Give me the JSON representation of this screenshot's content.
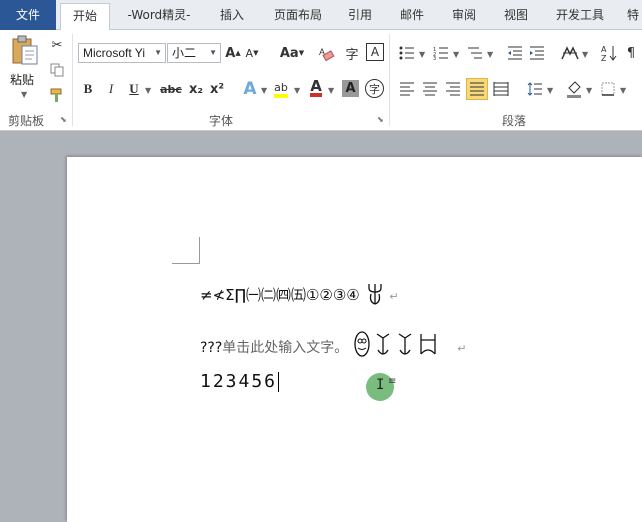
{
  "tabs": {
    "file": "文件",
    "home": "开始",
    "word_spirit": "-Word精灵-",
    "insert": "插入",
    "page_layout": "页面布局",
    "references": "引用",
    "mailings": "邮件",
    "review": "审阅",
    "view": "视图",
    "developer": "开发工具",
    "more": "特"
  },
  "ribbon": {
    "clipboard": {
      "paste_label": "粘贴",
      "group_label": "剪贴板"
    },
    "font": {
      "font_name": "Microsoft Yi",
      "font_size": "小二",
      "group_label": "字体",
      "bold": "B",
      "italic": "I",
      "underline": "U",
      "strike": "abc",
      "subscript": "x₂",
      "superscript": "x²",
      "grow": "A",
      "shrink": "A",
      "change_case": "Aa",
      "phonetic": "字",
      "border_char": "A",
      "text_effect": "A",
      "highlight": "ab",
      "font_color": "A",
      "char_shading": "A",
      "enclose": "字"
    },
    "paragraph": {
      "group_label": "段落"
    }
  },
  "document": {
    "symbols_line": "≠≮Σ∏㈠㈡㈣㈤①②③④",
    "special_glyph_1": "ꝋ",
    "text_prefix": "???",
    "text_placeholder": "单击此处输入文字。",
    "numbers": "123456",
    "para_mark": "↵"
  },
  "colors": {
    "file_tab": "#2b5797",
    "highlight_yellow": "#f7d97b",
    "font_color_red": "#d0302b",
    "cursor_green": "#6ab56f"
  }
}
